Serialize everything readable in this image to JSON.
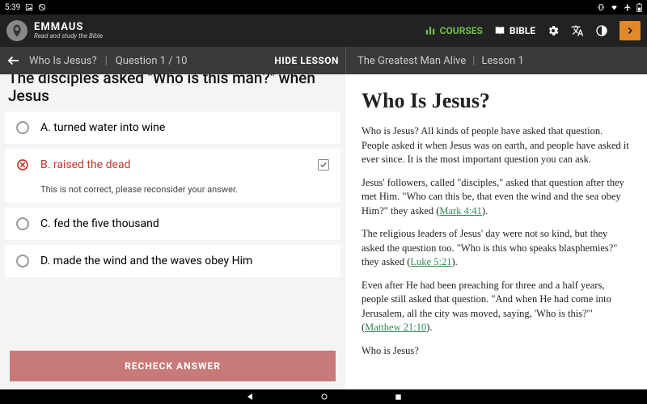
{
  "status": {
    "time": "5:39"
  },
  "app": {
    "title": "EMMAUS",
    "subtitle": "Read and study the Bible"
  },
  "nav": {
    "courses": "COURSES",
    "bible": "BIBLE"
  },
  "subbar": {
    "quiz_title": "Who Is Jesus?",
    "quiz_progress": "Question 1 / 10",
    "hide_lesson": "HIDE LESSON",
    "lesson_title": "The Greatest Man Alive",
    "lesson_num": "Lesson 1"
  },
  "quiz": {
    "question": "The disciples asked \"Who is this man?\" when Jesus",
    "options": {
      "a": "A. turned water into wine",
      "b": "B. raised the dead",
      "c": "C. fed the five thousand",
      "d": "D. made the wind and the waves obey Him"
    },
    "feedback": "This is not correct, please reconsider your answer.",
    "recheck": "RECHECK ANSWER"
  },
  "lesson": {
    "heading": "Who Is Jesus?",
    "p1": "Who is Jesus? All kinds of people have asked that question. People asked it when Jesus was on earth, and people have asked it ever since. It is the most important question you can ask.",
    "p2a": "Jesus' followers, called \"disciples,\" asked that question after they met Him. \"Who can this be, that even the wind and the sea obey Him?\" they asked (",
    "p2_ref": "Mark 4:41",
    "p2b": ").",
    "p3a": "The religious leaders of Jesus' day were not so kind, but they asked the question too. \"Who is this who speaks blasphemies?\" they asked (",
    "p3_ref": "Luke 5:21",
    "p3b": ").",
    "p4a": "Even after He had been preaching for three and a half years, people still asked that question. \"And when He had come into Jerusalem, all the city was moved, saying, 'Who is this?'\" (",
    "p4_ref": "Matthew 21:10",
    "p4b": ").",
    "p5": "Who is Jesus?"
  }
}
